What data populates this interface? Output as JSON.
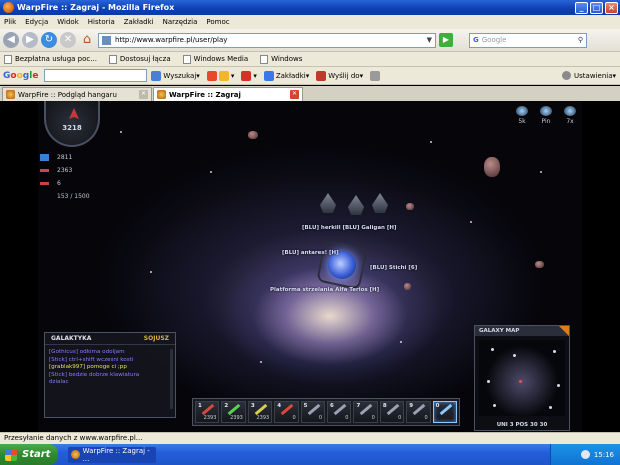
{
  "window": {
    "title": "WarpFire :: Zagraj - Mozilla Firefox"
  },
  "menu": [
    "Plik",
    "Edycja",
    "Widok",
    "Historia",
    "Zakładki",
    "Narzędzia",
    "Pomoc"
  ],
  "nav": {
    "url": "http://www.warpfire.pl/user/play",
    "search_placeholder": "Google"
  },
  "bookmarks": [
    "Bezpłatna usługa poc...",
    "Dostosuj łącza",
    "Windows Media",
    "Windows"
  ],
  "google_toolbar": {
    "logo": "Google",
    "search_label": "Wyszukaj",
    "bookmarks_label": "Zakładki",
    "send_label": "Wyślij do",
    "settings_label": "Ustawienia"
  },
  "tabs": [
    {
      "label": "WarpFire :: Podgląd hangaru",
      "active": false
    },
    {
      "label": "WarpFire :: Zagraj",
      "active": true
    }
  ],
  "game": {
    "radar_value": "3218",
    "stats": [
      {
        "icon": "cargo-icon",
        "value": "2811"
      },
      {
        "icon": "speed-icon",
        "value": "2363"
      },
      {
        "icon": "ammo-icon",
        "value": "6"
      },
      {
        "icon": "hp-icon",
        "value": "153 / 1500"
      }
    ],
    "hud_top_right": [
      "5k",
      "Pin",
      "7x"
    ],
    "labels": [
      "[BLU] herkill [BLU] Galigan [H]",
      "[BLU] antares! [H]",
      "[BLU] Stichi [6]",
      "Platforma strzelania Alfa Terios [H]"
    ],
    "chat": {
      "tabs": [
        "GALAKTYKA",
        "SOJUSZ"
      ],
      "messages": [
        {
          "text": "[Gothicus] odkima odoljam",
          "color": "#8c7cff"
        },
        {
          "text": "[Stick] ctrl+shift wcześni kostí",
          "color": "#8c7cff"
        },
        {
          "text": "[grablak997] pomoge ci ;pp",
          "color": "#e8e35a"
        },
        {
          "text": "[Stick] bedzie dobrze klawiatura",
          "color": "#8c7cff"
        },
        {
          "text": "dzialac",
          "color": "#8c7cff"
        }
      ]
    },
    "skills": [
      {
        "key": "1",
        "value": "2393",
        "color": "#d64a3a"
      },
      {
        "key": "2",
        "value": "2393",
        "color": "#5bd14e"
      },
      {
        "key": "3",
        "value": "2393",
        "color": "#d8d04a"
      },
      {
        "key": "4",
        "value": "0",
        "color": "#d64a3a"
      },
      {
        "key": "5",
        "value": "0",
        "color": "#9aa2b3"
      },
      {
        "key": "6",
        "value": "0",
        "color": "#9aa2b3"
      },
      {
        "key": "7",
        "value": "0",
        "color": "#9aa2b3"
      },
      {
        "key": "8",
        "value": "0",
        "color": "#9aa2b3"
      },
      {
        "key": "9",
        "value": "0",
        "color": "#9aa2b3"
      },
      {
        "key": "0",
        "value": "",
        "color": "#8fc6ff"
      }
    ],
    "galaxy_map": {
      "title": "GALAXY MAP",
      "position": "UNI 3 POS 30 30"
    }
  },
  "status_text": "Przesyłanie danych z www.warpfire.pl...",
  "taskbar": {
    "start": "Start",
    "item": "WarpFire :: Zagraj - ...",
    "clock": "15:16"
  }
}
